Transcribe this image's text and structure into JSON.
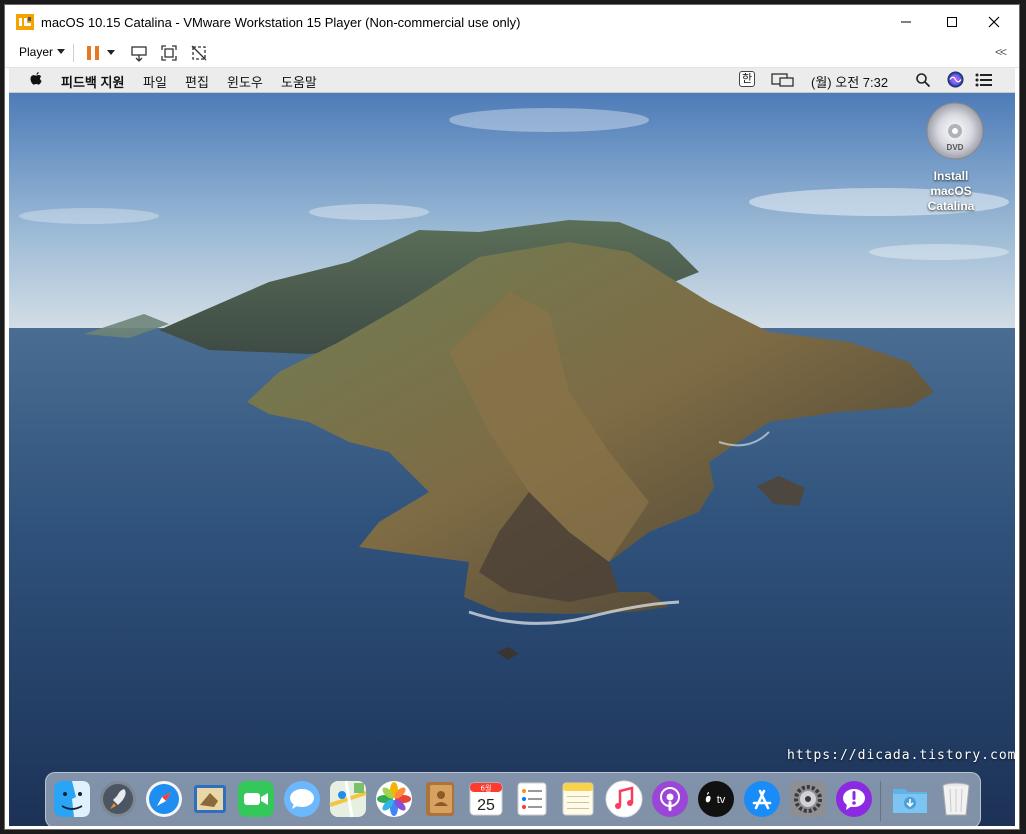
{
  "window": {
    "title": "macOS 10.15 Catalina - VMware Workstation 15 Player (Non-commercial use only)",
    "controls": [
      "minimize",
      "maximize",
      "close"
    ]
  },
  "toolbar": {
    "player_label": "Player",
    "collapse_label": "<<",
    "buttons": [
      "pause-icon",
      "send-ctrl-alt-del-icon",
      "fullscreen-icon",
      "unity-icon"
    ]
  },
  "menubar": {
    "app_name": "피드백 지원",
    "menus": [
      "파일",
      "편집",
      "윈도우",
      "도움말"
    ],
    "input_source": "한",
    "clock": "(월) 오전 7:32"
  },
  "desktop": {
    "dvd_label": "Install macOS Catalina"
  },
  "watermark": "https://dicada.tistory.com",
  "dock": {
    "apps": [
      {
        "name": "Finder",
        "icon": "finder-icon",
        "running": true
      },
      {
        "name": "Launchpad",
        "icon": "launchpad-icon",
        "running": false
      },
      {
        "name": "Safari",
        "icon": "safari-icon",
        "running": false
      },
      {
        "name": "Mail",
        "icon": "mail-icon",
        "running": false
      },
      {
        "name": "FaceTime",
        "icon": "facetime-icon",
        "running": false
      },
      {
        "name": "Messages",
        "icon": "messages-icon",
        "running": false
      },
      {
        "name": "Maps",
        "icon": "maps-icon",
        "running": false
      },
      {
        "name": "Photos",
        "icon": "photos-icon",
        "running": false
      },
      {
        "name": "Contacts",
        "icon": "contacts-icon",
        "running": false
      },
      {
        "name": "Calendar",
        "icon": "calendar-icon",
        "running": false,
        "month": "6월",
        "day": "25"
      },
      {
        "name": "Reminders",
        "icon": "reminders-icon",
        "running": false
      },
      {
        "name": "Notes",
        "icon": "notes-icon",
        "running": false
      },
      {
        "name": "Music",
        "icon": "music-icon",
        "running": false
      },
      {
        "name": "Podcasts",
        "icon": "podcasts-icon",
        "running": false
      },
      {
        "name": "TV",
        "icon": "tv-icon",
        "running": false,
        "label": "tv"
      },
      {
        "name": "App Store",
        "icon": "app-store-icon",
        "running": false
      },
      {
        "name": "System Preferences",
        "icon": "system-preferences-icon",
        "running": false
      },
      {
        "name": "Feedback Assistant",
        "icon": "feedback-assistant-icon",
        "running": true
      },
      {
        "name": "Downloads",
        "icon": "downloads-folder-icon",
        "running": false
      },
      {
        "name": "Trash",
        "icon": "trash-icon",
        "running": false
      }
    ]
  },
  "colors": {
    "pause": "#e87722",
    "menubar_bg": "#ececec",
    "sky_top": "#4d7bb8",
    "ocean": "#244068"
  }
}
